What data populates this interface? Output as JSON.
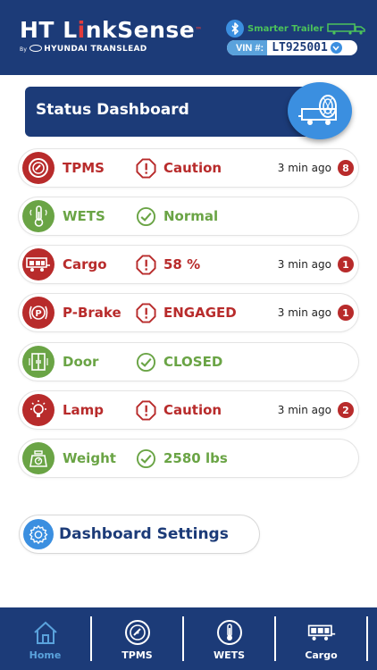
{
  "header": {
    "brand_ht": "HT",
    "brand_link_pre": "L",
    "brand_link_i": "i",
    "brand_link_post": "nkSense",
    "brand_tm": "™",
    "brand_by": "By",
    "brand_sub": "HYUNDAI TRANSLEAD",
    "smart_trailer": "Smarter Trailer",
    "vin_label": "VIN #:",
    "vin_value": "LT925001"
  },
  "banner": {
    "title": "Status Dashboard"
  },
  "rows": [
    {
      "name": "TPMS",
      "status": "Caution",
      "time": "3 min ago",
      "count": "8",
      "state": "alert"
    },
    {
      "name": "WETS",
      "status": "Normal",
      "state": "ok"
    },
    {
      "name": "Cargo",
      "status": "58 %",
      "time": "3 min ago",
      "count": "1",
      "state": "alert"
    },
    {
      "name": "P-Brake",
      "status": "ENGAGED",
      "time": "3 min ago",
      "count": "1",
      "state": "alert"
    },
    {
      "name": "Door",
      "status": "CLOSED",
      "state": "ok"
    },
    {
      "name": "Lamp",
      "status": "Caution",
      "time": "3 min ago",
      "count": "2",
      "state": "alert"
    },
    {
      "name": "Weight",
      "status": "2580 lbs",
      "state": "ok"
    }
  ],
  "settings": {
    "label": "Dashboard Settings"
  },
  "nav": [
    {
      "label": "Home",
      "icon": "home-icon",
      "active": true
    },
    {
      "label": "TPMS",
      "icon": "tire-icon"
    },
    {
      "label": "WETS",
      "icon": "thermometer-icon"
    },
    {
      "label": "Cargo",
      "icon": "cargo-icon"
    }
  ],
  "colors": {
    "navy": "#1c3b78",
    "alert_red": "#b82b2b",
    "ok_green": "#6aa445",
    "accent_blue": "#3b8fe0"
  }
}
